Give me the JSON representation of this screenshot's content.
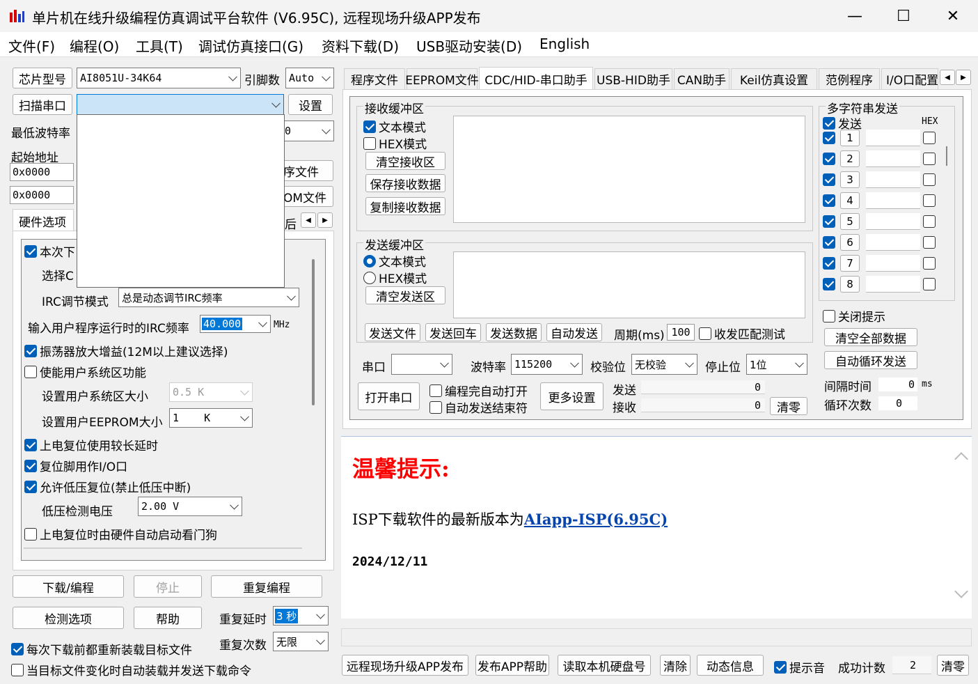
{
  "window": {
    "title": "单片机在线升级编程仿真调试平台软件 (V6.95C), 远程现场升级APP发布",
    "minimize": "—",
    "maximize": "☐",
    "close": "✕"
  },
  "menu": [
    "文件(F)",
    "编程(O)",
    "工具(T)",
    "调试仿真接口(G)",
    "资料下载(D)",
    "USB驱动安装(D)",
    "English"
  ],
  "left": {
    "chip_label": "芯片型号",
    "chip_value": "AI8051U-34K64",
    "pins_label": "引脚数",
    "pins_value": "Auto",
    "scan_button": "扫描串口",
    "port_value": "",
    "settings_button": "设置",
    "min_baud_label": "最低波特率",
    "max_baud_partial": "0",
    "start_addr_label": "起始地址",
    "addr1": "0x0000",
    "addr2": "0x0000",
    "open_prog_partial": "序文件",
    "open_eeprom_partial": "OM文件",
    "tab_hardware": "硬件选项",
    "tab_partial": "后",
    "opt_this_time_partial": "本次下",
    "opt_select_partial": "选择C",
    "irc_mode_label": "IRC调节模式",
    "irc_mode_value": "总是动态调节IRC频率",
    "irc_freq_label": "输入用户程序运行时的IRC频率",
    "irc_freq_value": "40.000",
    "irc_freq_unit": "MHz",
    "osc_gain": "振荡器放大增益(12M以上建议选择)",
    "user_sys_area": "使能用户系统区功能",
    "sys_area_size_label": "设置用户系统区大小",
    "sys_area_size_value": "0.5 K",
    "eeprom_size_label": "设置用户EEPROM大小",
    "eeprom_size_value": "1    K",
    "long_reset": "上电复位使用较长延时",
    "reset_io": "复位脚用作I/O口",
    "low_volt_reset": "允许低压复位(禁止低压中断)",
    "low_volt_label": "低压检测电压",
    "low_volt_value": "2.00 V",
    "watchdog": "上电复位时由硬件自动启动看门狗",
    "download_button": "下载/编程",
    "stop_button": "停止",
    "reprogram_button": "重复编程",
    "check_button": "检测选项",
    "help_button": "帮助",
    "repeat_delay_label": "重复延时",
    "repeat_delay_value": "3 秒",
    "repeat_count_label": "重复次数",
    "repeat_count_value": "无限",
    "reload_each": "每次下载前都重新装载目标文件",
    "auto_reload": "当目标文件变化时自动装载并发送下载命令"
  },
  "tabs": [
    "程序文件",
    "EEPROM文件",
    "CDC/HID-串口助手",
    "USB-HID助手",
    "CAN助手",
    "Keil仿真设置",
    "范例程序",
    "I/O口配置"
  ],
  "serial": {
    "rx_group": "接收缓冲区",
    "rx_text_mode": "文本模式",
    "rx_hex_mode": "HEX模式",
    "clear_rx": "清空接收区",
    "save_rx": "保存接收数据",
    "copy_rx": "复制接收数据",
    "tx_group": "发送缓冲区",
    "tx_text_mode": "文本模式",
    "tx_hex_mode": "HEX模式",
    "clear_tx": "清空发送区",
    "send_file": "发送文件",
    "send_enter": "发送回车",
    "send_data": "发送数据",
    "auto_send": "自动发送",
    "period_label": "周期(ms)",
    "period_value": "100",
    "loop_test": "收发匹配测试",
    "port_label": "串口",
    "port_value": "",
    "baud_label": "波特率",
    "baud_value": "115200",
    "parity_label": "校验位",
    "parity_value": "无校验",
    "stop_label": "停止位",
    "stop_value": "1位",
    "open_port": "打开串口",
    "auto_open": "编程完自动打开",
    "auto_end": "自动发送结束符",
    "more_settings": "更多设置",
    "tx_label": "发送",
    "tx_count": "0",
    "rx_label": "接收",
    "rx_count": "0",
    "clear_count": "清零"
  },
  "multi": {
    "group": "多字符串发送",
    "send_label": "发送",
    "hex_label": "HEX",
    "rows": [
      "1",
      "2",
      "3",
      "4",
      "5",
      "6",
      "7",
      "8"
    ],
    "close_hint": "关闭提示",
    "clear_all": "清空全部数据",
    "auto_loop": "自动循环发送",
    "interval_label": "间隔时间",
    "interval_value": "0",
    "interval_unit": "ms",
    "loop_label": "循环次数",
    "loop_value": "0"
  },
  "notice": {
    "heading": "温馨提示:",
    "line": "ISP下载软件的最新版本为",
    "link": "AIapp-ISP(6.95C)",
    "date": "2024/12/11"
  },
  "bottom": {
    "publish": "远程现场升级APP发布",
    "publish_help": "发布APP帮助",
    "read_disk": "读取本机硬盘号",
    "clear": "清除",
    "dynamic": "动态信息",
    "beep": "提示音",
    "success_label": "成功计数",
    "success_value": "2",
    "reset": "清零"
  },
  "colors": {
    "accent": "#005fb8",
    "notice_red": "#ff0000",
    "link_blue": "#0645ad"
  }
}
